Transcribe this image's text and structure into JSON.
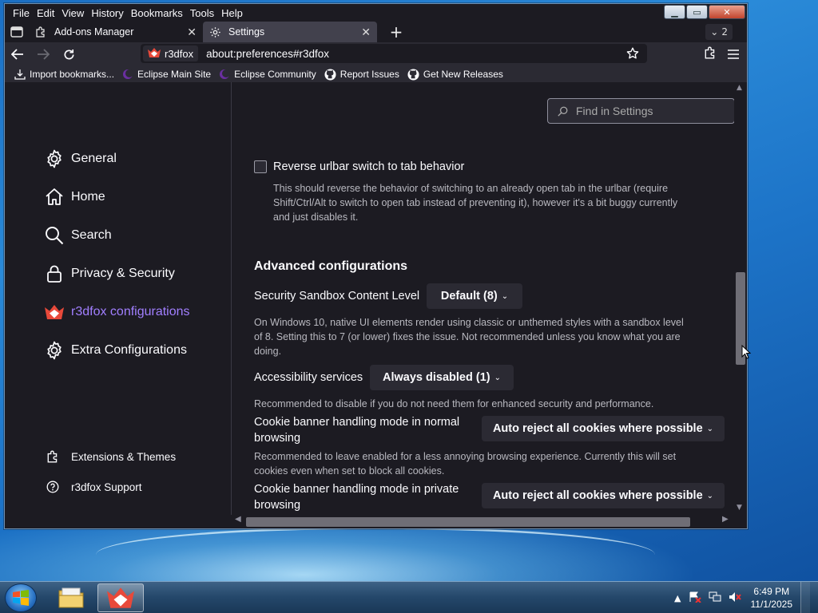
{
  "menu": [
    "File",
    "Edit",
    "View",
    "History",
    "Bookmarks",
    "Tools",
    "Help"
  ],
  "tabs": [
    {
      "label": "Add-ons Manager",
      "icon": "puzzle-icon",
      "active": false
    },
    {
      "label": "Settings",
      "icon": "gear-icon",
      "active": true
    }
  ],
  "tab_count": "2",
  "url": {
    "identity": "r3dfox",
    "address": "about:preferences#r3dfox"
  },
  "bookmarks": [
    {
      "label": "Import bookmarks...",
      "icon": "import-icon"
    },
    {
      "label": "Eclipse Main Site",
      "icon": "eclipse-icon"
    },
    {
      "label": "Eclipse Community",
      "icon": "eclipse-icon"
    },
    {
      "label": "Report Issues",
      "icon": "github-icon"
    },
    {
      "label": "Get New Releases",
      "icon": "github-icon"
    }
  ],
  "search_placeholder": "Find in Settings",
  "sidebar": {
    "categories": [
      {
        "label": "General",
        "icon": "gear-icon"
      },
      {
        "label": "Home",
        "icon": "home-icon"
      },
      {
        "label": "Search",
        "icon": "search-icon"
      },
      {
        "label": "Privacy & Security",
        "icon": "lock-icon"
      },
      {
        "label": "r3dfox configurations",
        "icon": "r3dfox-logo-icon",
        "selected": true
      },
      {
        "label": "Extra Configurations",
        "icon": "gear-icon"
      }
    ],
    "footer": [
      {
        "label": "Extensions & Themes",
        "icon": "puzzle-icon"
      },
      {
        "label": "r3dfox Support",
        "icon": "help-icon"
      }
    ]
  },
  "main": {
    "urlbar_switch": {
      "label": "Reverse urlbar switch to tab behavior",
      "checked": false,
      "description_lines": [
        "This should reverse the behavior of switching to an already open tab in the urlbar (require",
        "Shift/Ctrl/Alt to switch to open tab instead of preventing it), however it's a bit buggy currently",
        "and just disables it."
      ]
    },
    "section_title": "Advanced configurations",
    "sandbox": {
      "label": "Security Sandbox Content Level",
      "value": "Default (8)",
      "description_lines": [
        "On Windows 10, native UI elements render using classic or unthemed styles with a sandbox level",
        "of 8. Setting this to 7 (or lower) fixes the issue. Not recommended unless you know what you are",
        "doing."
      ]
    },
    "accessibility": {
      "label": "Accessibility services",
      "value": "Always disabled (1)",
      "description": "Recommended to disable if you do not need them for enhanced security and performance."
    },
    "cookie_normal": {
      "label_lines": [
        "Cookie banner handling mode in normal",
        "browsing"
      ],
      "value": "Auto reject all cookies where possible",
      "description_lines": [
        "Recommended to leave enabled for a less annoying browsing experience. Currently this will set",
        "cookies even when set to block all cookies."
      ]
    },
    "cookie_private": {
      "label_lines": [
        "Cookie banner handling mode in private",
        "browsing"
      ],
      "value": "Auto reject all cookies where possible"
    }
  },
  "taskbar": {
    "time": "6:49 PM",
    "date": "11/1/2025"
  },
  "colors": {
    "accent": "#a17fff",
    "window_bg": "#1c1b22",
    "toolbar_bg": "#2b2a33"
  }
}
